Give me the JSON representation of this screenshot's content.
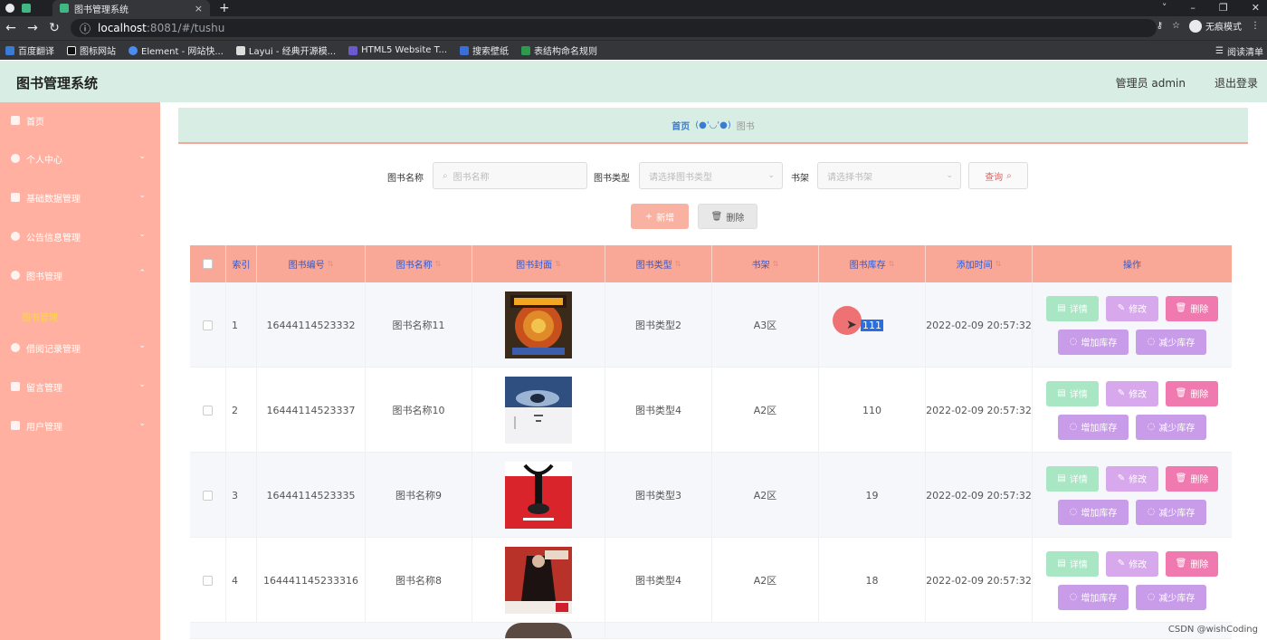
{
  "browser": {
    "tab_title": "图书管理系统",
    "tab_close": "×",
    "new_tab": "+",
    "url_host": "localhost",
    "url_path": ":8081/#/tushu",
    "incognito_label": "无痕模式",
    "reading_list": "阅读清单",
    "bookmarks": [
      "百度翻译",
      "图标网站",
      "Element - 网站快...",
      "Layui - 经典开源模...",
      "HTML5 Website T...",
      "搜索壁纸",
      "表结构命名规则"
    ],
    "window_controls": [
      "˅",
      "–",
      "❐",
      "✕"
    ]
  },
  "header": {
    "title": "图书管理系统",
    "user": "管理员 admin",
    "logout": "退出登录"
  },
  "sidebar": {
    "items": [
      {
        "label": "首页"
      },
      {
        "label": "个人中心"
      },
      {
        "label": "基础数据管理"
      },
      {
        "label": "公告信息管理"
      },
      {
        "label": "图书管理"
      },
      {
        "label": "借阅记录管理"
      },
      {
        "label": "留言管理"
      },
      {
        "label": "用户管理"
      }
    ],
    "sub_active": "图书管理"
  },
  "breadcrumb": {
    "home": "首页",
    "face": "(●'◡'●)",
    "current": "图书"
  },
  "search": {
    "name_label": "图书名称",
    "name_placeholder": "图书名称",
    "type_label": "图书类型",
    "type_placeholder": "请选择图书类型",
    "shelf_label": "书架",
    "shelf_placeholder": "请选择书架",
    "query_button": "查询"
  },
  "actions": {
    "add": "新增",
    "delete": "删除"
  },
  "table": {
    "headers": [
      "索引",
      "图书编号",
      "图书名称",
      "图书封面",
      "图书类型",
      "书架",
      "图书库存",
      "添加时间",
      "操作"
    ],
    "op_labels": {
      "detail": "详情",
      "edit": "修改",
      "remove": "删除",
      "inc": "增加库存",
      "dec": "减少库存"
    },
    "rows": [
      {
        "index": "1",
        "code": "16444114523332",
        "name": "图书名称11",
        "type": "图书类型2",
        "shelf": "A3区",
        "stock": "111",
        "time": "2022-02-09 20:57:32"
      },
      {
        "index": "2",
        "code": "16444114523337",
        "name": "图书名称10",
        "type": "图书类型4",
        "shelf": "A2区",
        "stock": "110",
        "time": "2022-02-09 20:57:32"
      },
      {
        "index": "3",
        "code": "16444114523335",
        "name": "图书名称9",
        "type": "图书类型3",
        "shelf": "A2区",
        "stock": "19",
        "time": "2022-02-09 20:57:32"
      },
      {
        "index": "4",
        "code": "164441145233316",
        "name": "图书名称8",
        "type": "图书类型4",
        "shelf": "A2区",
        "stock": "18",
        "time": "2022-02-09 20:57:32"
      }
    ]
  },
  "watermark": "CSDN @wishCoding"
}
